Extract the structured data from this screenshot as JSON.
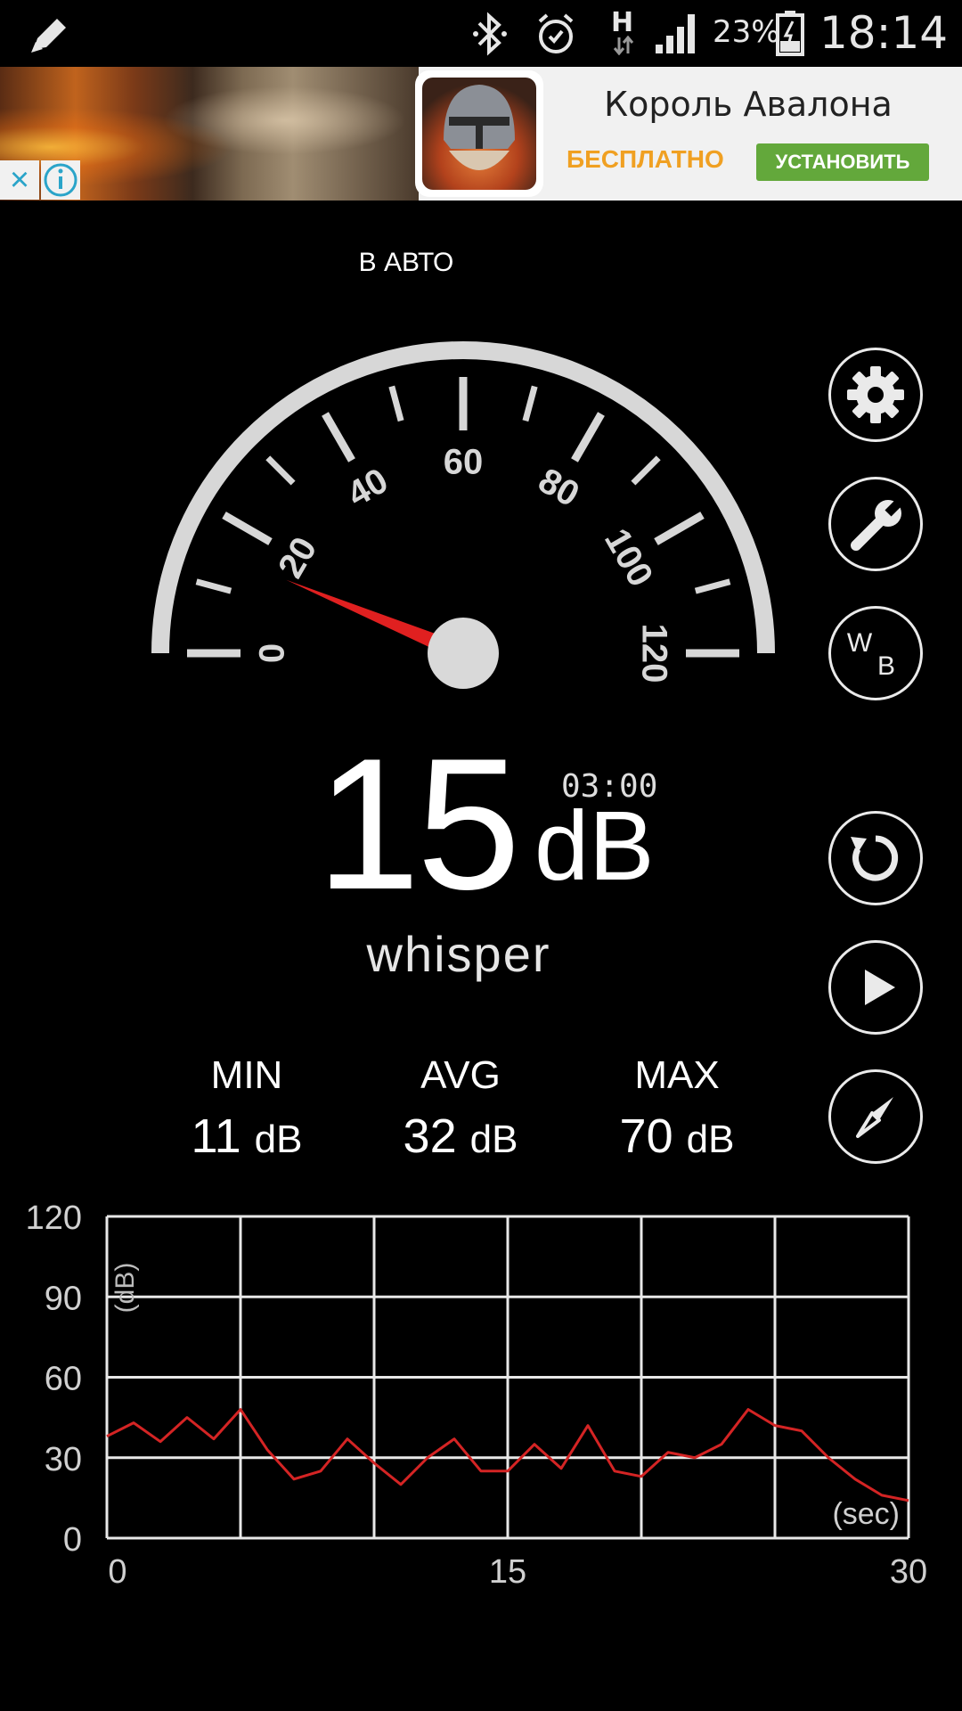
{
  "status_bar": {
    "battery_percent": "23%",
    "time": "18:14",
    "network_type": "H",
    "icons": [
      "edit-icon",
      "bluetooth-icon",
      "alarm-icon",
      "signal-icon",
      "battery-icon"
    ]
  },
  "ad": {
    "title": "Король Авалона",
    "price_label": "БЕСПЛАТНО",
    "install_label": "УСТАНОВИТЬ",
    "close_symbol": "×",
    "price_color": "#f0a022",
    "install_color": "#63a83b"
  },
  "mode_label": "В АВТО",
  "gauge": {
    "ticks": [
      "0",
      "20",
      "40",
      "60",
      "80",
      "100",
      "120"
    ],
    "min": 0,
    "max": 120,
    "needle_value": 15,
    "needle_color": "#e02020"
  },
  "side_buttons": [
    "gear-icon",
    "wrench-icon",
    "white-balance-icon",
    "reset-icon",
    "play-icon",
    "compass-icon"
  ],
  "wb_label": {
    "w": "W",
    "b": "B"
  },
  "readout": {
    "value": "15",
    "unit": "dB",
    "timer": "03:00",
    "description": "whisper"
  },
  "stats": [
    {
      "label": "MIN",
      "value": "11",
      "unit": "dB"
    },
    {
      "label": "AVG",
      "value": "32",
      "unit": "dB"
    },
    {
      "label": "MAX",
      "value": "70",
      "unit": "dB"
    }
  ],
  "chart_data": {
    "type": "line",
    "ylabel": "(dB)",
    "xlabel": "(sec)",
    "ylim": [
      0,
      120
    ],
    "xlim": [
      0,
      30
    ],
    "y_ticks": [
      "120",
      "90",
      "60",
      "30",
      "0"
    ],
    "x_ticks": [
      "0",
      "15",
      "30"
    ],
    "grid": true,
    "line_color": "#d42424",
    "series": [
      {
        "x": [
          0,
          1,
          2,
          3,
          4,
          5,
          6,
          7,
          8,
          9,
          10,
          11,
          12,
          13,
          14,
          15,
          16,
          17,
          18,
          19,
          20,
          21,
          22,
          23,
          24,
          25,
          26,
          27,
          28,
          29,
          30
        ],
        "values": [
          38,
          43,
          36,
          45,
          37,
          48,
          33,
          22,
          25,
          37,
          28,
          20,
          30,
          37,
          25,
          25,
          35,
          26,
          42,
          25,
          23,
          32,
          30,
          35,
          48,
          42,
          40,
          30,
          22,
          16,
          14
        ]
      }
    ]
  }
}
